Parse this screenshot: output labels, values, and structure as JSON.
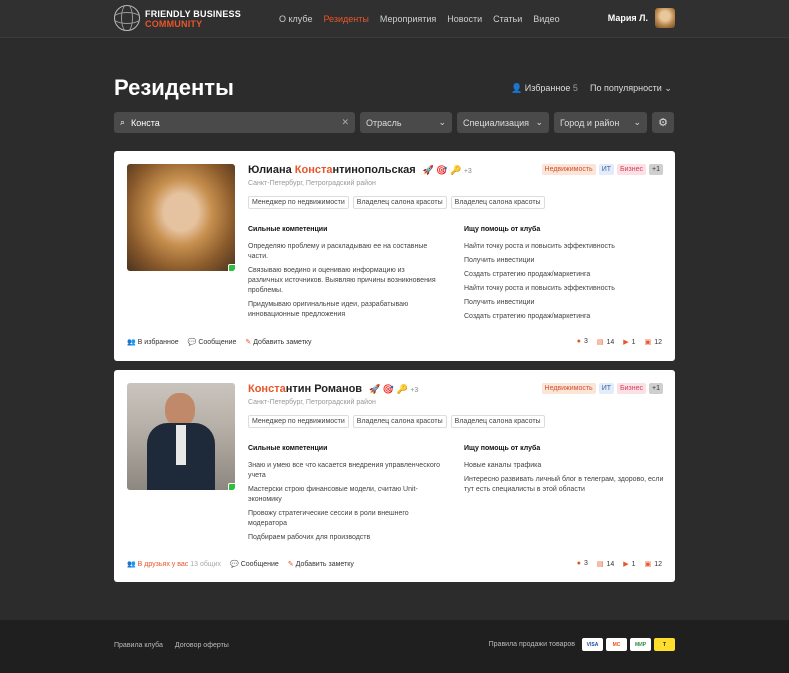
{
  "brand": {
    "line1": "FRIENDLY BUSINESS",
    "line2": "COMMUNITY"
  },
  "nav": [
    "О клубе",
    "Резиденты",
    "Мероприятия",
    "Новости",
    "Статьи",
    "Видео"
  ],
  "nav_active": 1,
  "user": {
    "name": "Мария Л."
  },
  "page": {
    "title": "Резиденты",
    "favorites_label": "Избранное",
    "favorites_count": "5",
    "sort_label": "По популярности"
  },
  "filters": {
    "search_value": "Конста",
    "city": "Отрасль",
    "spec": "Специализация",
    "district": "Город и район"
  },
  "cards": [
    {
      "name_pre": "Юлиана ",
      "name_hl": "Конста",
      "name_post": "нтинопольская",
      "more": "+3",
      "location": "Санкт-Петербург, Петроградский район",
      "tags": [
        "Менеджер по недвижимости",
        "Владелец салона красоты",
        "Владелец салона красоты"
      ],
      "badges": [
        "Недвижимость",
        "ИТ",
        "Бизнес",
        "+1"
      ],
      "strengths_title": "Сильные компетенции",
      "strengths": [
        "Определяю проблему и раскладываю ее на составные части.",
        "Связываю воедино и оцениваю информацию из различных источников. Выявляю причины возникновения проблемы.",
        "Придумываю оригинальные идеи, разрабатываю инновационные предложения"
      ],
      "help_title": "Ищу помощь от клуба",
      "help": [
        "Найти точку роста и повысить эффективность",
        "Получить инвестиции",
        "Создать стратегию продаж/маркетинга",
        "Найти точку роста и повысить эффективность",
        "Получить инвестиции",
        "Создать стратегию продаж/маркетинга"
      ],
      "act1": "В избранное",
      "act2": "Сообщение",
      "act3": "Добавить заметку",
      "counts": [
        "3",
        "14",
        "1",
        "12"
      ]
    },
    {
      "name_pre": "",
      "name_hl": "Конста",
      "name_post": "нтин Романов",
      "more": "+3",
      "location": "Санкт-Петербург, Петроградский район",
      "tags": [
        "Менеджер по недвижимости",
        "Владелец салона красоты",
        "Владелец салона красоты"
      ],
      "badges": [
        "Недвижимость",
        "ИТ",
        "Бизнес",
        "+1"
      ],
      "strengths_title": "Сильные компетенции",
      "strengths": [
        "Знаю и умею все что касается внедрения управленческого учета",
        "Мастерски строю финансовые модели, считаю Unit-экономику",
        "Провожу стратегические сессии в роли внешнего модератора",
        "Подбираем рабочих для производств"
      ],
      "help_title": "Ищу помощь от клуба",
      "help": [
        "Новые каналы трафика",
        "Интересно развивать личный блог в телеграм, здорово, если тут есть специалисты в этой области"
      ],
      "act1": "В друзьях у вас",
      "act1_mut": "13 общих",
      "act2": "Сообщение",
      "act3": "Добавить заметку",
      "counts": [
        "3",
        "14",
        "1",
        "12"
      ]
    }
  ],
  "footer": {
    "links": [
      "Правила клуба",
      "Договор оферты"
    ],
    "sales": "Правила продажи товаров",
    "pay": [
      "VISA",
      "MC",
      "МИР",
      "T"
    ]
  }
}
